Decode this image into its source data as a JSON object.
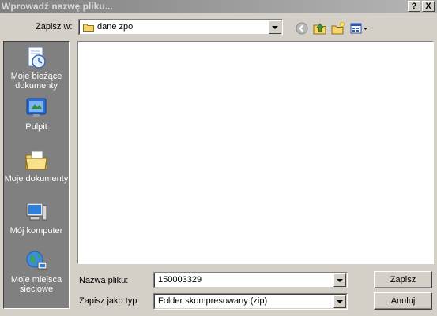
{
  "window": {
    "title": "Wprowadź nazwę pliku...",
    "help_label": "?",
    "close_label": "X"
  },
  "save_in": {
    "label": "Zapisz w:",
    "value": "dane zpo"
  },
  "places": [
    {
      "label": "Moje bieżące dokumenty"
    },
    {
      "label": "Pulpit"
    },
    {
      "label": "Moje dokumenty"
    },
    {
      "label": "Mój komputer"
    },
    {
      "label": "Moje miejsca sieciowe"
    }
  ],
  "filename": {
    "label": "Nazwa pliku:",
    "value": "150003329"
  },
  "filetype": {
    "label": "Zapisz jako typ:",
    "value": "Folder skompresowany (zip)"
  },
  "buttons": {
    "save": "Zapisz",
    "cancel": "Anuluj"
  },
  "icons": {
    "back": "back-icon",
    "up": "up-folder-icon",
    "new_folder": "new-folder-icon",
    "views": "views-menu-icon"
  }
}
